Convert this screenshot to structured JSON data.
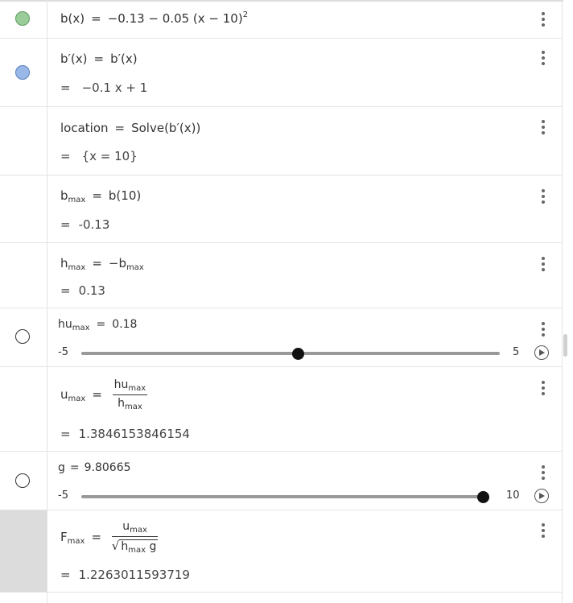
{
  "rows": [
    {
      "name": "b",
      "lhs": "b(x)",
      "rhs": "−0.13 − 0.05 (x − 10)",
      "rhs_sup": "2",
      "dot": "green"
    },
    {
      "name": "bprime",
      "lhs": "b′(x)",
      "rhs": "b′(x)",
      "out": "−0.1 x + 1",
      "dot": "blue"
    },
    {
      "name": "location",
      "lhs": "location",
      "rhs": "Solve(b′(x))",
      "out": "{x = 10}"
    },
    {
      "name": "bmax",
      "lhs": "b",
      "lhs_sub": "max",
      "rhs": "b(10)",
      "out": "-0.13"
    },
    {
      "name": "hmax",
      "lhs": "h",
      "lhs_sub": "max",
      "rhs": "−b",
      "rhs_sub": "max",
      "out": "0.13"
    },
    {
      "name": "humax",
      "lhs": "hu",
      "lhs_sub": "max",
      "rhs": "0.18",
      "slider": {
        "min": "-5",
        "max": "5",
        "value": 0.18,
        "range": [
          -5,
          5
        ]
      },
      "dot": "empty"
    },
    {
      "name": "umax",
      "lhs": "u",
      "lhs_sub": "max",
      "num": "hu",
      "num_sub": "max",
      "den": "h",
      "den_sub": "max",
      "out": "1.3846153846154"
    },
    {
      "name": "g",
      "lhs": "g",
      "rhs": "9.80665",
      "slider": {
        "min": "-5",
        "max": "10",
        "value": 9.80665,
        "range": [
          -5,
          10
        ]
      },
      "dot": "empty"
    },
    {
      "name": "Fmax",
      "lhs": "F",
      "lhs_sub": "max",
      "num": "u",
      "num_sub": "max",
      "den": "h",
      "den_sub": "max",
      "den_tail": "g",
      "out": "1.2263011593719"
    }
  ],
  "symbols": {
    "equals": "=",
    "result_equals": "="
  }
}
